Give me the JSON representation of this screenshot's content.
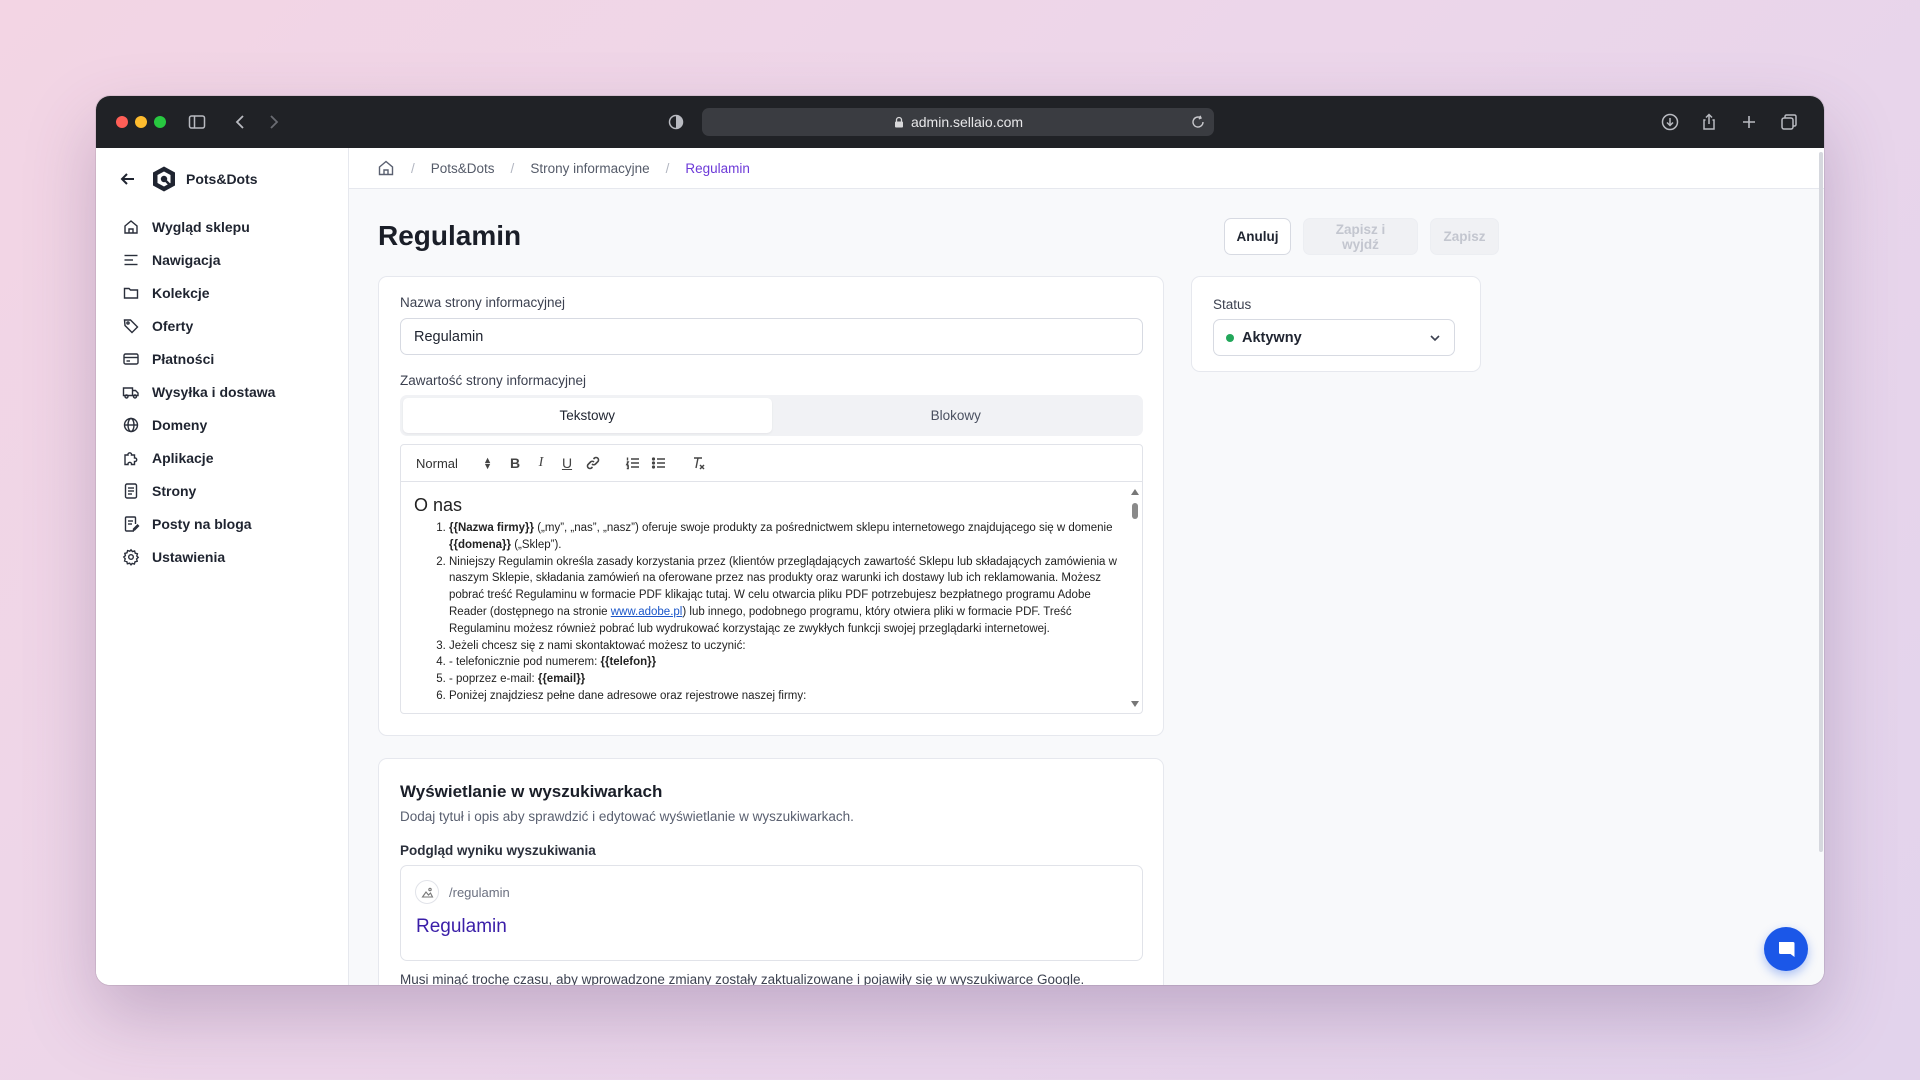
{
  "browser": {
    "url": "admin.sellaio.com"
  },
  "sidebar": {
    "brand": "Pots&Dots",
    "items": [
      {
        "label": "Wygląd sklepu",
        "icon": "storefront-icon"
      },
      {
        "label": "Nawigacja",
        "icon": "menu-lines-icon"
      },
      {
        "label": "Kolekcje",
        "icon": "folder-icon"
      },
      {
        "label": "Oferty",
        "icon": "tag-icon"
      },
      {
        "label": "Płatności",
        "icon": "credit-card-icon"
      },
      {
        "label": "Wysyłka i dostawa",
        "icon": "truck-icon"
      },
      {
        "label": "Domeny",
        "icon": "globe-icon"
      },
      {
        "label": "Aplikacje",
        "icon": "puzzle-icon"
      },
      {
        "label": "Strony",
        "icon": "page-icon"
      },
      {
        "label": "Posty na bloga",
        "icon": "blog-post-icon"
      },
      {
        "label": "Ustawienia",
        "icon": "gear-icon"
      }
    ]
  },
  "breadcrumb": {
    "items": [
      "Pots&Dots",
      "Strony informacyjne"
    ],
    "current": "Regulamin"
  },
  "page": {
    "title": "Regulamin",
    "actions": {
      "cancel": "Anuluj",
      "save_exit": "Zapisz i wyjdź",
      "save": "Zapisz"
    }
  },
  "form": {
    "name_label": "Nazwa strony informacyjnej",
    "name_value": "Regulamin",
    "content_label": "Zawartość strony informacyjnej",
    "tabs": [
      "Tekstowy",
      "Blokowy"
    ],
    "active_tab": "Tekstowy",
    "editor": {
      "format_select": "Normal",
      "heading": "O nas",
      "items": [
        {
          "b1": "{{Nazwa firmy}}",
          "t1": " („my”, „nas”, „nasz”) oferuje swoje produkty za pośrednictwem sklepu internetowego znajdującego się w domenie ",
          "b2": "{{domena}}",
          "t2": " („Sklep”)."
        },
        {
          "t1": "Niniejszy Regulamin określa zasady korzystania przez (klientów przeglądających zawartość Sklepu lub składających zamówienia w naszym Sklepie, składania zamówień na oferowane przez nas produkty oraz warunki ich dostawy lub ich reklamowania. Możesz pobrać treść Regulaminu w formacie PDF klikając tutaj. W celu otwarcia pliku PDF potrzebujesz bezpłatnego programu Adobe Reader (dostępnego na stronie ",
          "link": "www.adobe.pl",
          "t2": ") lub innego, podobnego programu, który otwiera pliki w formacie PDF. Treść Regulaminu możesz również pobrać lub wydrukować korzystając ze zwykłych funkcji swojej przeglądarki internetowej."
        },
        {
          "t1": "Jeżeli chcesz się z nami skontaktować możesz to uczynić:"
        },
        {
          "t1": "- telefonicznie pod numerem: ",
          "b1": "{{telefon}}"
        },
        {
          "t1": "- poprzez e-mail: ",
          "b1": "{{email}}"
        },
        {
          "t1": "Poniżej znajdziesz pełne dane adresowe oraz rejestrowe naszej firmy:"
        }
      ]
    }
  },
  "status": {
    "label": "Status",
    "value": "Aktywny",
    "color": "#22a75a"
  },
  "seo": {
    "title": "Wyświetlanie w wyszukiwarkach",
    "description": "Dodaj tytuł i opis aby sprawdzić i edytować wyświetlanie w wyszukiwarkach.",
    "preview_label": "Podgląd wyniku wyszukiwania",
    "preview_url": "/regulamin",
    "preview_title": "Regulamin",
    "note": "Musi minąć trochę czasu, aby wprowadzone zmiany zostały zaktualizowane i pojawiły się w wyszukiwarce Google."
  },
  "colors": {
    "accent": "#6d3ad8",
    "link": "#3a1ea8",
    "chat": "#1b57e8"
  }
}
